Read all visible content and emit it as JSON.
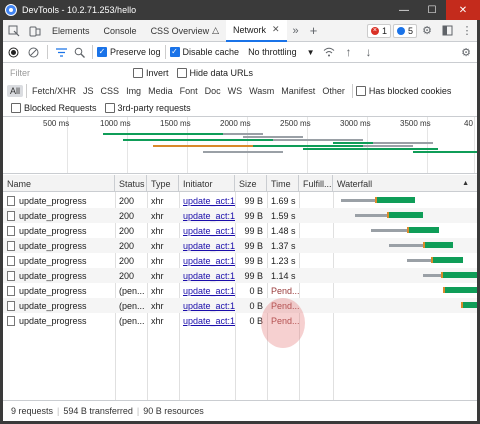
{
  "window": {
    "title": "DevTools - 10.2.71.253/hello"
  },
  "tabs": {
    "items": [
      {
        "label": "Elements"
      },
      {
        "label": "Console"
      },
      {
        "label": "CSS Overview"
      },
      {
        "label": "Network"
      }
    ],
    "badges": {
      "errors": "1",
      "issues": "5"
    }
  },
  "toolbar": {
    "preserve_log": "Preserve log",
    "disable_cache": "Disable cache",
    "throttling": "No throttling"
  },
  "filter": {
    "placeholder": "Filter",
    "invert": "Invert",
    "hide_data_urls": "Hide data URLs",
    "types": [
      "All",
      "Fetch/XHR",
      "JS",
      "CSS",
      "Img",
      "Media",
      "Font",
      "Doc",
      "WS",
      "Wasm",
      "Manifest",
      "Other"
    ],
    "has_blocked_cookies": "Has blocked cookies",
    "blocked_requests": "Blocked Requests",
    "third_party": "3rd-party requests"
  },
  "overview": {
    "ticks": [
      "500 ms",
      "1000 ms",
      "1500 ms",
      "2000 ms",
      "2500 ms",
      "3000 ms",
      "3500 ms",
      "40"
    ]
  },
  "table": {
    "headers": {
      "name": "Name",
      "status": "Status",
      "type": "Type",
      "initiator": "Initiator",
      "size": "Size",
      "time": "Time",
      "fulfill": "Fulfill...",
      "waterfall": "Waterfall"
    },
    "rows": [
      {
        "name": "update_progress",
        "status": "200",
        "type": "xhr",
        "initiator": "update_act:1",
        "size": "99 B",
        "time": "1.69 s"
      },
      {
        "name": "update_progress",
        "status": "200",
        "type": "xhr",
        "initiator": "update_act:1",
        "size": "99 B",
        "time": "1.59 s"
      },
      {
        "name": "update_progress",
        "status": "200",
        "type": "xhr",
        "initiator": "update_act:1",
        "size": "99 B",
        "time": "1.48 s"
      },
      {
        "name": "update_progress",
        "status": "200",
        "type": "xhr",
        "initiator": "update_act:1",
        "size": "99 B",
        "time": "1.37 s"
      },
      {
        "name": "update_progress",
        "status": "200",
        "type": "xhr",
        "initiator": "update_act:1",
        "size": "99 B",
        "time": "1.23 s"
      },
      {
        "name": "update_progress",
        "status": "200",
        "type": "xhr",
        "initiator": "update_act:1",
        "size": "99 B",
        "time": "1.14 s"
      },
      {
        "name": "update_progress",
        "status": "(pen...",
        "type": "xhr",
        "initiator": "update_act:1",
        "size": "0 B",
        "time": "Pend..."
      },
      {
        "name": "update_progress",
        "status": "(pen...",
        "type": "xhr",
        "initiator": "update_act:1",
        "size": "0 B",
        "time": "Pend..."
      },
      {
        "name": "update_progress",
        "status": "(pen...",
        "type": "xhr",
        "initiator": "update_act:1",
        "size": "0 B",
        "time": "Pend..."
      }
    ]
  },
  "status": {
    "requests": "9 requests",
    "transferred": "594 B transferred",
    "resources": "90 B resources"
  },
  "colors": {
    "accent": "#1a73e8",
    "waiting": "#9aa0a6",
    "download": "#0f9d58",
    "error": "#d93025"
  }
}
